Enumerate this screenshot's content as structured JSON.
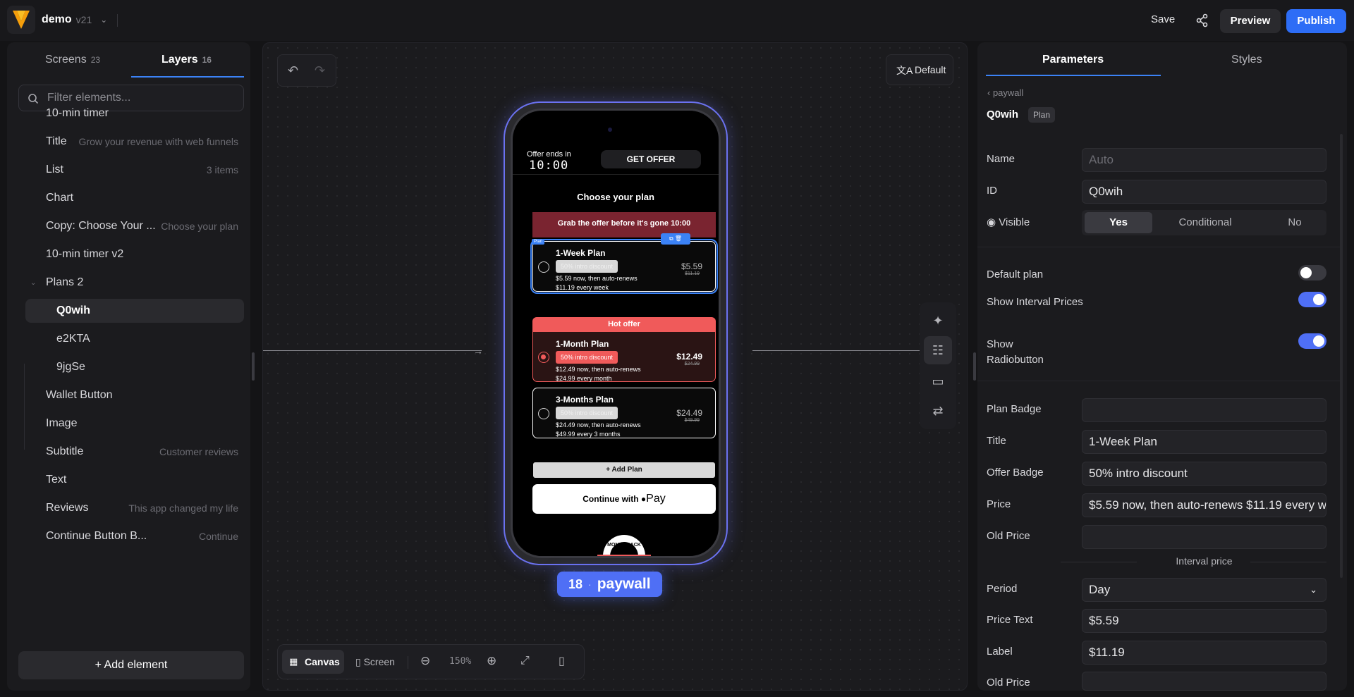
{
  "topbar": {
    "project_name": "demo",
    "version": "v21",
    "save_label": "Save",
    "preview_label": "Preview",
    "publish_label": "Publish"
  },
  "left": {
    "tabs": [
      {
        "label": "Screens",
        "count": "23"
      },
      {
        "label": "Layers",
        "count": "16"
      }
    ],
    "filter_placeholder": "Filter elements...",
    "layers": [
      {
        "name": "10-min timer",
        "hint": ""
      },
      {
        "name": "Title",
        "hint": "Grow your revenue with web funnels"
      },
      {
        "name": "List",
        "hint": "3 items"
      },
      {
        "name": "Chart",
        "hint": ""
      },
      {
        "name": "Copy: Choose Your ...",
        "hint": "Choose your plan"
      },
      {
        "name": "10-min timer v2",
        "hint": ""
      },
      {
        "name": "Plans 2",
        "hint": ""
      },
      {
        "name": "Q0wih",
        "hint": ""
      },
      {
        "name": "e2KTA",
        "hint": ""
      },
      {
        "name": "9jgSe",
        "hint": ""
      },
      {
        "name": "Wallet Button",
        "hint": ""
      },
      {
        "name": "Image",
        "hint": ""
      },
      {
        "name": "Subtitle",
        "hint": "Customer reviews"
      },
      {
        "name": "Text",
        "hint": ""
      },
      {
        "name": "Reviews",
        "hint": "This app changed my life"
      },
      {
        "name": "Continue Button B...",
        "hint": "Continue"
      }
    ],
    "add_element_label": "Add element"
  },
  "canvas": {
    "language_label": "Default",
    "bottom": {
      "canvas_label": "Canvas",
      "screen_label": "Screen",
      "zoom": "150%"
    },
    "screen_badge": {
      "number": "18",
      "name": "paywall"
    }
  },
  "phone": {
    "offer_ends": "Offer ends in",
    "timer": "10:00",
    "get_offer": "GET OFFER",
    "choose": "Choose your plan",
    "grab": "Grab the offer before it's gone 10:00",
    "plan_tag": "Plan",
    "hot_offer": "Hot offer",
    "plans": [
      {
        "title": "1-Week Plan",
        "badge": "50% intro discount",
        "desc1": "$5.59 now, then auto-renews",
        "desc2": "$11.19 every week",
        "price": "$5.59",
        "old": "$11.19"
      },
      {
        "title": "1-Month Plan",
        "badge": "50% intro discount",
        "desc1": "$12.49 now, then auto-renews",
        "desc2": "$24.99 every month",
        "price": "$12.49",
        "old": "$24.99"
      },
      {
        "title": "3-Months Plan",
        "badge": "50% intro discount",
        "desc1": "$24.49 now, then auto-renews",
        "desc2": "$49.99 every 3 months",
        "price": "$24.49",
        "old": "$49.99"
      }
    ],
    "add_plan": "Add Plan",
    "apple_pay_prefix": "Continue with",
    "apple_pay_suffix": "Pay",
    "seal_text": "MONEY BACK"
  },
  "right": {
    "tabs": [
      "Parameters",
      "Styles"
    ],
    "breadcrumb": "paywall",
    "element_id": "Q0wih",
    "element_type": "Plan",
    "name_label": "Name",
    "name_placeholder": "Auto",
    "id_label": "ID",
    "id_value": "Q0wih",
    "visible_label": "Visible",
    "visible_options": [
      "Yes",
      "Conditional",
      "No"
    ],
    "default_plan_label": "Default plan",
    "show_interval_label": "Show Interval Prices",
    "show_radio_label": "Show Radiobutton",
    "plan_badge_label": "Plan Badge",
    "plan_badge_value": "",
    "title_label": "Title",
    "title_value": "1-Week Plan",
    "offer_badge_label": "Offer Badge",
    "offer_badge_value": "50% intro discount",
    "price_label": "Price",
    "price_value": "$5.59 now, then auto-renews $11.19 every week",
    "old_price_label": "Old Price",
    "old_price_value": "",
    "interval_header": "Interval price",
    "period_label": "Period",
    "period_value": "Day",
    "price_text_label": "Price Text",
    "price_text_value": "$5.59",
    "label_label": "Label",
    "label_value": "$11.19",
    "old_price2_label": "Old Price",
    "toggles": {
      "default_plan": false,
      "show_interval": true,
      "show_radio": true
    }
  },
  "colors": {
    "accent": "#2d6df6",
    "toggle_on": "#4f6ff5",
    "hot": "#f05a5a",
    "grab_bg": "#7a2430"
  }
}
